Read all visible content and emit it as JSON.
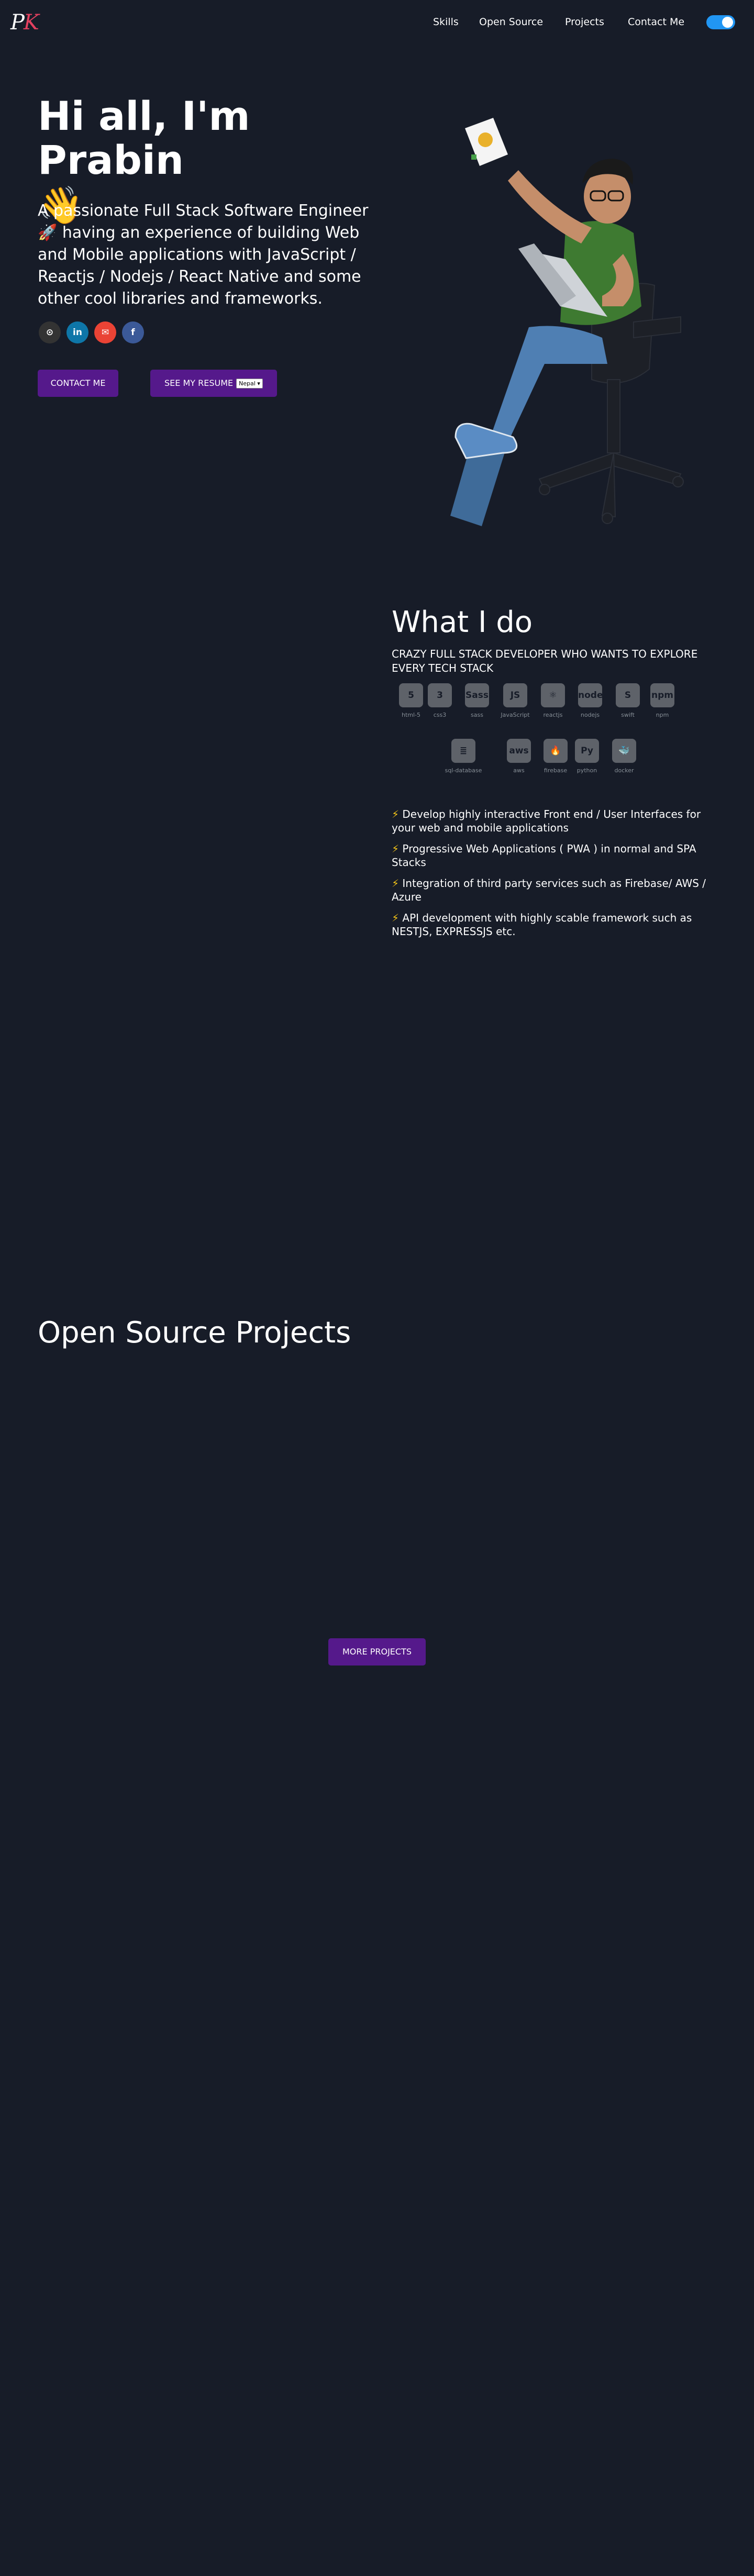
{
  "header": {
    "logo_part1": "P",
    "logo_part2": "K",
    "nav": [
      "Skills",
      "Open Source",
      "Projects",
      "Contact Me"
    ]
  },
  "hero": {
    "greeting": "Hi all, I'm Prabin",
    "wave_emoji": "👋",
    "subtitle": "A passionate Full Stack Software Engineer 🚀 having an experience of building Web and Mobile applications with JavaScript / Reactjs / Nodejs / React Native and some other cool libraries and frameworks.",
    "socials": [
      {
        "icon": "github-icon",
        "glyph": "⊙"
      },
      {
        "icon": "linkedin-icon",
        "glyph": "in"
      },
      {
        "icon": "gmail-icon",
        "glyph": "✉"
      },
      {
        "icon": "facebook-icon",
        "glyph": "f"
      }
    ],
    "contact_button": "CONTACT ME",
    "resume_button": "SEE MY RESUME",
    "resume_language": "Nepal"
  },
  "what_i_do": {
    "title": "What I do",
    "subtitle": "CRAZY FULL STACK DEVELOPER WHO WANTS TO EXPLORE EVERY TECH STACK",
    "skills": [
      {
        "name": "html-5",
        "glyph": "5",
        "icon": "html5-icon"
      },
      {
        "name": "css3",
        "glyph": "3",
        "icon": "css3-icon"
      },
      {
        "name": "sass",
        "glyph": "Sass",
        "icon": "sass-icon"
      },
      {
        "name": "JavaScript",
        "glyph": "JS",
        "icon": "javascript-icon"
      },
      {
        "name": "reactjs",
        "glyph": "⚛",
        "icon": "react-icon"
      },
      {
        "name": "nodejs",
        "glyph": "node",
        "icon": "nodejs-icon"
      },
      {
        "name": "swift",
        "glyph": "S",
        "icon": "swift-icon"
      },
      {
        "name": "npm",
        "glyph": "npm",
        "icon": "npm-icon"
      },
      {
        "name": "sql-database",
        "glyph": "≣",
        "icon": "database-icon"
      },
      {
        "name": "aws",
        "glyph": "aws",
        "icon": "aws-icon"
      },
      {
        "name": "firebase",
        "glyph": "🔥",
        "icon": "firebase-icon"
      },
      {
        "name": "python",
        "glyph": "Py",
        "icon": "python-icon"
      },
      {
        "name": "docker",
        "glyph": "🐳",
        "icon": "docker-icon"
      }
    ],
    "bolt": "⚡",
    "bullets": [
      "Develop highly interactive Front end / User Interfaces for your web and mobile applications",
      "Progressive Web Applications ( PWA ) in normal and SPA Stacks",
      "Integration of third party services such as Firebase/ AWS / Azure",
      "API development with highly scable framework such as NESTJS, EXPRESSJS etc."
    ]
  },
  "open_source": {
    "title": "Open Source Projects",
    "more_button": "MORE PROJECTS"
  },
  "colors": {
    "background": "#171c28",
    "accent": "#55198b",
    "toggle": "#2196f3",
    "logo_accent": "#e3405f"
  }
}
